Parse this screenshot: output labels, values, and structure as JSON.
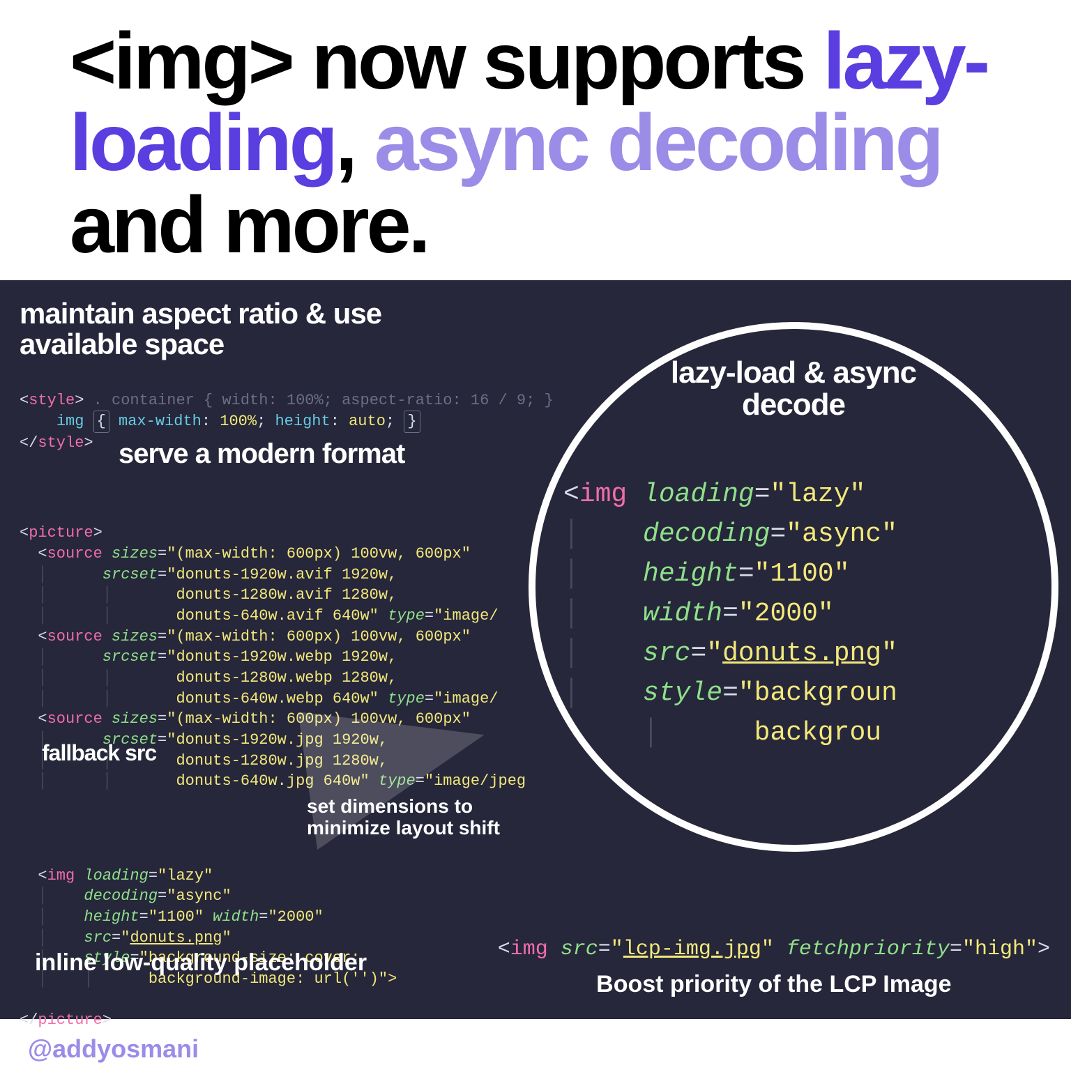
{
  "header": {
    "part1": "<img> now supports ",
    "lazy": "lazy-loading",
    "comma": ", ",
    "async": "async decoding",
    "rest": " and more."
  },
  "labels": {
    "aspect": "maintain aspect ratio & use available space",
    "serve": "serve a modern format",
    "fallback": "fallback src",
    "dimensions": "set dimensions to minimize layout shift",
    "inline": "inline low-quality placeholder",
    "lazy": "lazy-load & async decode",
    "lcp": "Boost priority of the LCP Image"
  },
  "style_code": {
    "s1": "<style>",
    "cmt": " . container { width: 100%; aspect-ratio: 16 / 9; }",
    "img": "img",
    "brace_l": "{",
    "mw": "max-width",
    "mw_v": "100%",
    "h": "height",
    "h_v": "auto",
    "brace_r": "}",
    "s2": "</style>"
  },
  "picture": {
    "open": "<picture>",
    "close": "</picture>",
    "sources": [
      {
        "sizes": "\"(max-width: 600px) 100vw, 600px\"",
        "srcset": "\"donuts-1920w.avif 1920w,",
        "l2": "donuts-1280w.avif 1280w,",
        "l3": "donuts-640w.avif 640w\"",
        "type": "\"image/"
      },
      {
        "sizes": "\"(max-width: 600px) 100vw, 600px\"",
        "srcset": "\"donuts-1920w.webp 1920w,",
        "l2": "donuts-1280w.webp 1280w,",
        "l3": "donuts-640w.webp 640w\"",
        "type": "\"image/"
      },
      {
        "sizes": "\"(max-width: 600px) 100vw, 600px\"",
        "srcset": "\"donuts-1920w.jpg 1920w,",
        "l2": "donuts-1280w.jpg 1280w,",
        "l3": "donuts-640w.jpg 640w\"",
        "type": "\"image/jpeg"
      }
    ],
    "img": {
      "loading": "\"lazy\"",
      "decoding": "\"async\"",
      "height": "\"1100\"",
      "width": "\"2000\"",
      "src": "donuts.png",
      "style1": "\"background-size: cover;",
      "style2": "background-image: url('')\">"
    }
  },
  "mag": {
    "loading": "\"lazy\"",
    "decoding": "\"async\"",
    "height": "\"1100\"",
    "width": "\"2000\"",
    "src": "donuts.png",
    "style1": "\"backgroun",
    "style2": "backgrou"
  },
  "lcp_code": {
    "src": "lcp-img.jpg",
    "fp": "\"high\""
  },
  "footer": "@addyosmani"
}
